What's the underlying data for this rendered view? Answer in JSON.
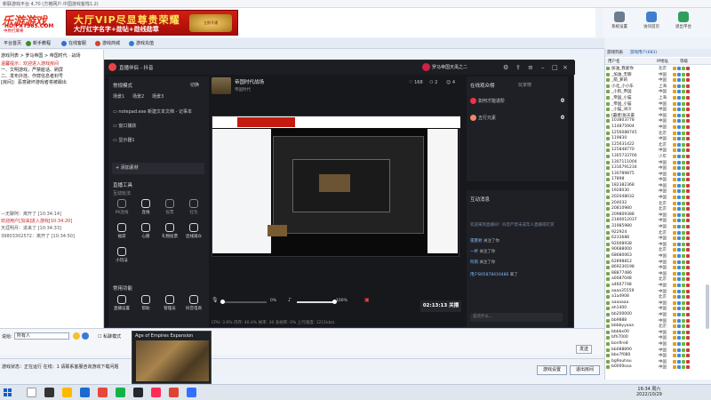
{
  "outer": {
    "window_title": "新联游戏平台 4.70 (方格网户.中国游戏客栈1.2)",
    "logo": {
      "big": "乐游游戏",
      "url": "HD.FXT365.COM",
      "slogan": "中原打麻将"
    },
    "ad": {
      "line1": "大厅VIP尽显尊贵荣耀",
      "line2": "大厅红字名字+勋钻+勋线勋章",
      "badge": "立即开通"
    },
    "top_buttons": [
      {
        "label": "系统设置"
      },
      {
        "label": "访问首页"
      },
      {
        "label": "退出平台"
      }
    ],
    "nav_tabs": [
      {
        "label": "平台首页"
      },
      {
        "label": "新手教程"
      },
      {
        "label": "在线客服"
      },
      {
        "label": "游戏商城"
      },
      {
        "label": "游戏充值"
      }
    ],
    "breadcrumb": "游戏列表 > 罗马帝国 > 帝国时代 · 战场",
    "left_lines": [
      {
        "text": "温馨提示：欢迎进入游戏房间",
        "cls": "lp-red"
      },
      {
        "text": "一、文明游戏，严禁脏话、刷屏",
        "cls": ""
      },
      {
        "text": "二、发布外挂、作弊信息者封号",
        "cls": ""
      },
      {
        "text": "[房间]：恶意破坏游戏者将被踢出",
        "cls": ""
      },
      {
        "text": "—无聊阿：离开了 [10:34:14]",
        "cls": "lp-gray"
      },
      {
        "text": "欢迎用户[加油]进入游戏[10:34:20]",
        "cls": "lp-red"
      },
      {
        "text": "天涯明月：进来了 [10:34:33]",
        "cls": "lp-gray"
      },
      {
        "text": "39803302572：离开了 [10:34:50]",
        "cls": "lp-gray"
      }
    ],
    "chat": {
      "label": "说给:",
      "target": "所有人",
      "checkbox": "私聊模式",
      "send": "发送"
    },
    "status_text": "游戏状态：正在运行  在线：1  请联系客服咨询游戏下载问题",
    "bottom_buttons": [
      {
        "label": "游戏设置"
      },
      {
        "label": "退出房间"
      }
    ],
    "thumbnail_title": "Age of Empires Expansion",
    "taskbar": {
      "time": "16:34 周六",
      "date": "2022/10/29"
    }
  },
  "user_panel": {
    "tabs": [
      "游戏列表",
      "游戏用户(683)"
    ],
    "columns": [
      "用户名",
      "IP地址",
      "等级"
    ],
    "users": [
      {
        "name": "加油_我爱你",
        "loc": "北京"
      },
      {
        "name": "_加油_无聊",
        "loc": "中国"
      },
      {
        "name": "_萌_萝莉",
        "loc": "中国"
      },
      {
        "name": "小北_小小乐",
        "loc": "上海"
      },
      {
        "name": "_小狗_帝国",
        "loc": "中国"
      },
      {
        "name": "_帝国_小猫",
        "loc": "上海"
      },
      {
        "name": "_帝国_小猫",
        "loc": "中国"
      },
      {
        "name": "_小猫_冰冷",
        "loc": "中国"
      },
      {
        "name": "[霸者]张天豪",
        "loc": "中国"
      },
      {
        "name": "103803778",
        "loc": "中国"
      },
      {
        "name": "114875904",
        "loc": "中国"
      },
      {
        "name": "1256088745",
        "loc": "北京"
      },
      {
        "name": "119830",
        "loc": "中国"
      },
      {
        "name": "125631422",
        "loc": "北京"
      },
      {
        "name": "125848770",
        "loc": "中国"
      },
      {
        "name": "1305733700",
        "loc": "少年"
      },
      {
        "name": "1307111004",
        "loc": "中国"
      },
      {
        "name": "1316791234",
        "loc": "中国"
      },
      {
        "name": "130789875",
        "loc": "中国"
      },
      {
        "name": "17898",
        "loc": "中国"
      },
      {
        "name": "182382368",
        "loc": "中国"
      },
      {
        "name": "1928030",
        "loc": "中国"
      },
      {
        "name": "202048032",
        "loc": "中国"
      },
      {
        "name": "204032",
        "loc": "北京"
      },
      {
        "name": "20810980",
        "loc": "北京"
      },
      {
        "name": "209809388",
        "loc": "中国"
      },
      {
        "name": "2180012037",
        "loc": "中国"
      },
      {
        "name": "31985980",
        "loc": "中国"
      },
      {
        "name": "922924",
        "loc": "北京"
      },
      {
        "name": "6233688",
        "loc": "中国"
      },
      {
        "name": "92008938",
        "loc": "中国"
      },
      {
        "name": "90688000",
        "loc": "北京"
      },
      {
        "name": "68680063",
        "loc": "中国"
      },
      {
        "name": "62898812",
        "loc": "中国"
      },
      {
        "name": "869230198",
        "loc": "中国"
      },
      {
        "name": "88877486",
        "loc": "中国"
      },
      {
        "name": "a0087048",
        "loc": "北京"
      },
      {
        "name": "a4607748",
        "loc": "中国"
      },
      {
        "name": "aaaa35559",
        "loc": "中国"
      },
      {
        "name": "a1a4908",
        "loc": "北京"
      },
      {
        "name": "aaaaaaa",
        "loc": "中国"
      },
      {
        "name": "ah1400",
        "loc": "中国"
      },
      {
        "name": "bb200000",
        "loc": "中国"
      },
      {
        "name": "bb9888",
        "loc": "中国"
      },
      {
        "name": "bbbbyyaaa",
        "loc": "北京"
      },
      {
        "name": "bbbbx00",
        "loc": "中国"
      },
      {
        "name": "bfh7000",
        "loc": "中国"
      },
      {
        "name": "bonfire8",
        "loc": "中国"
      },
      {
        "name": "bb088890",
        "loc": "中国"
      },
      {
        "name": "bbx7f080",
        "loc": "中国"
      },
      {
        "name": "bg9ouhau",
        "loc": "中国"
      },
      {
        "name": "b0000oaa",
        "loc": "中国"
      }
    ]
  },
  "stream_app": {
    "title": "直播伴侣 - 抖音",
    "user": "罗马帝国天禹之二",
    "left": {
      "section1_title": "常规模式",
      "section1_link": "切换",
      "scene_tabs": [
        "场景1",
        "场景2",
        "场景3"
      ],
      "sources": [
        {
          "label": "notepad.exe 新建文本文档 - 记事本"
        },
        {
          "label": "窗口捕获"
        },
        {
          "label": "显示器1"
        }
      ],
      "add_source": "+ 添加素材",
      "tools_title": "直播工具",
      "interact_title": "互动玩法",
      "tools": [
        {
          "label": "PK连线",
          "on": false
        },
        {
          "label": "连线",
          "on": true
        },
        {
          "label": "投票",
          "on": false
        },
        {
          "label": "红包",
          "on": false
        },
        {
          "label": "福袋",
          "on": true
        },
        {
          "label": "心愿",
          "on": true
        },
        {
          "label": "礼物投票",
          "on": true
        },
        {
          "label": "连线观众",
          "on": true
        },
        {
          "label": "小玩法",
          "on": true
        }
      ],
      "general_title": "常用功能",
      "general": [
        {
          "label": "直播设置"
        },
        {
          "label": "帮助"
        },
        {
          "label": "管理员"
        },
        {
          "label": "抖音电商"
        }
      ]
    },
    "center": {
      "room_name": "帝国时代战场",
      "room_sub": "帝国时代",
      "likes": "168",
      "viewers": "2",
      "online": "4",
      "mic_volume": "0%",
      "speaker_volume": "100%",
      "live_time": "02:13:13",
      "live_label": "关播",
      "status": "CPU: 3.6%   内存: 40.4%   帧率: 30   丢帧率: 0%   上行速度: 1211kb/s"
    },
    "right": {
      "audience_title": "在线观众榜",
      "audience_link": "玩家榜",
      "ranks": [
        {
          "name": "如何才能进阶",
          "value": "0"
        },
        {
          "name": "五行元素",
          "value": "0"
        }
      ],
      "chat_title": "互动消息",
      "notice": "欢迎来到直播间！抖音严禁未成年人直播或打赏",
      "messages": [
        {
          "user": "雷霆君",
          "text": "关注了你"
        },
        {
          "user": "一杯",
          "text": "关注了你"
        },
        {
          "user": "阿雨",
          "text": "关注了你"
        },
        {
          "user": "用户805878416486",
          "text": "来了"
        }
      ],
      "chat_placeholder": "说点什么..."
    }
  }
}
